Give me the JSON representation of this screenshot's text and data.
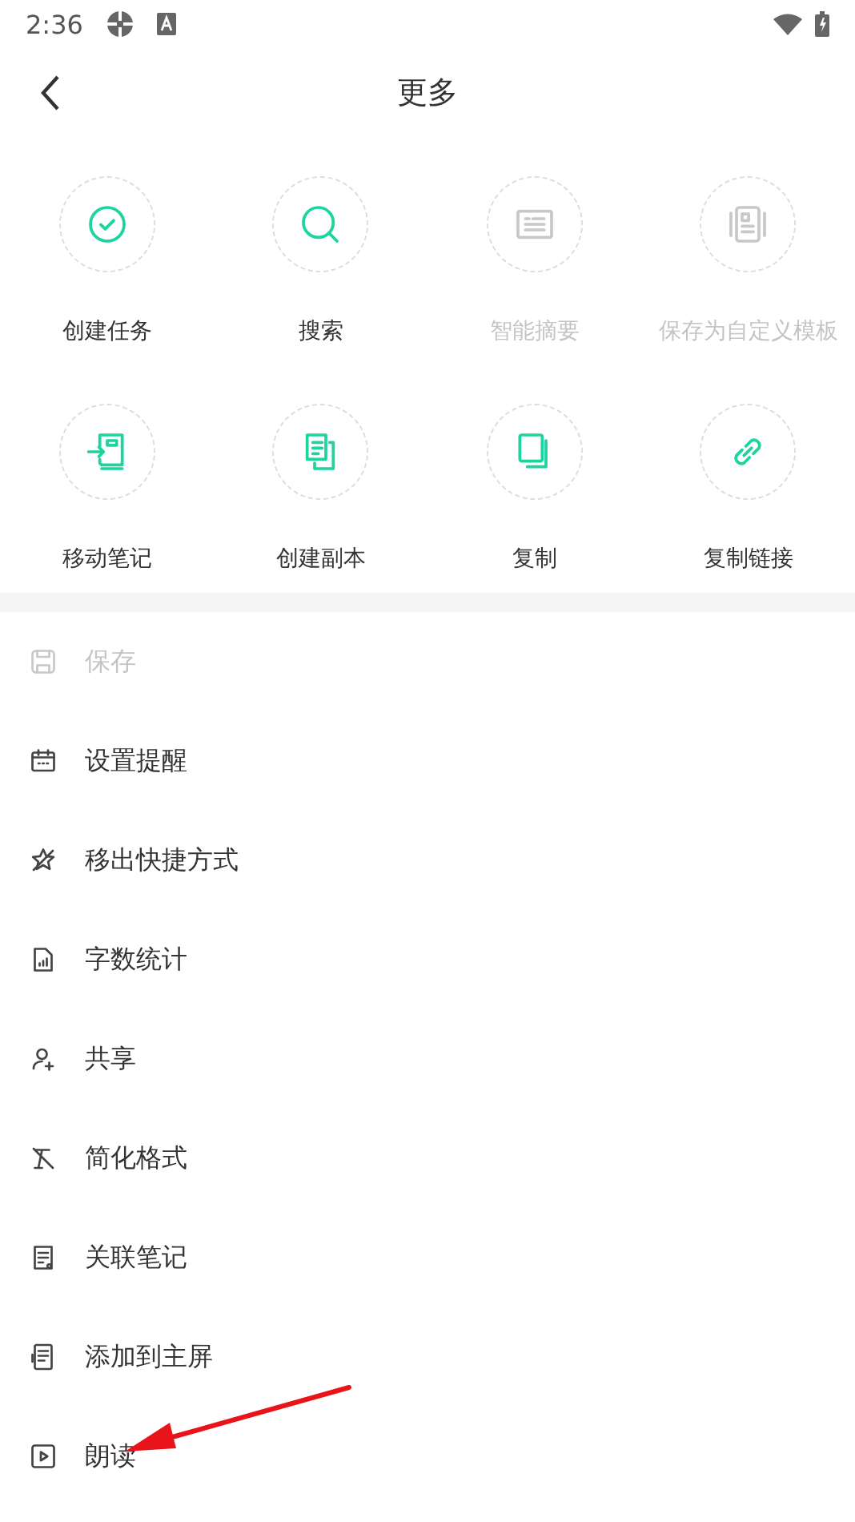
{
  "status_bar": {
    "time": "2:36"
  },
  "header": {
    "title": "更多"
  },
  "grid": [
    {
      "label": "创建任务",
      "disabled": false
    },
    {
      "label": "搜索",
      "disabled": false
    },
    {
      "label": "智能摘要",
      "disabled": true
    },
    {
      "label": "保存为自定义模板",
      "disabled": true
    },
    {
      "label": "移动笔记",
      "disabled": false
    },
    {
      "label": "创建副本",
      "disabled": false
    },
    {
      "label": "复制",
      "disabled": false
    },
    {
      "label": "复制链接",
      "disabled": false
    }
  ],
  "menu": [
    {
      "label": "保存",
      "disabled": true
    },
    {
      "label": "设置提醒",
      "disabled": false
    },
    {
      "label": "移出快捷方式",
      "disabled": false
    },
    {
      "label": "字数统计",
      "disabled": false
    },
    {
      "label": "共享",
      "disabled": false
    },
    {
      "label": "简化格式",
      "disabled": false
    },
    {
      "label": "关联笔记",
      "disabled": false
    },
    {
      "label": "添加到主屏",
      "disabled": false
    },
    {
      "label": "朗读",
      "disabled": false
    }
  ]
}
